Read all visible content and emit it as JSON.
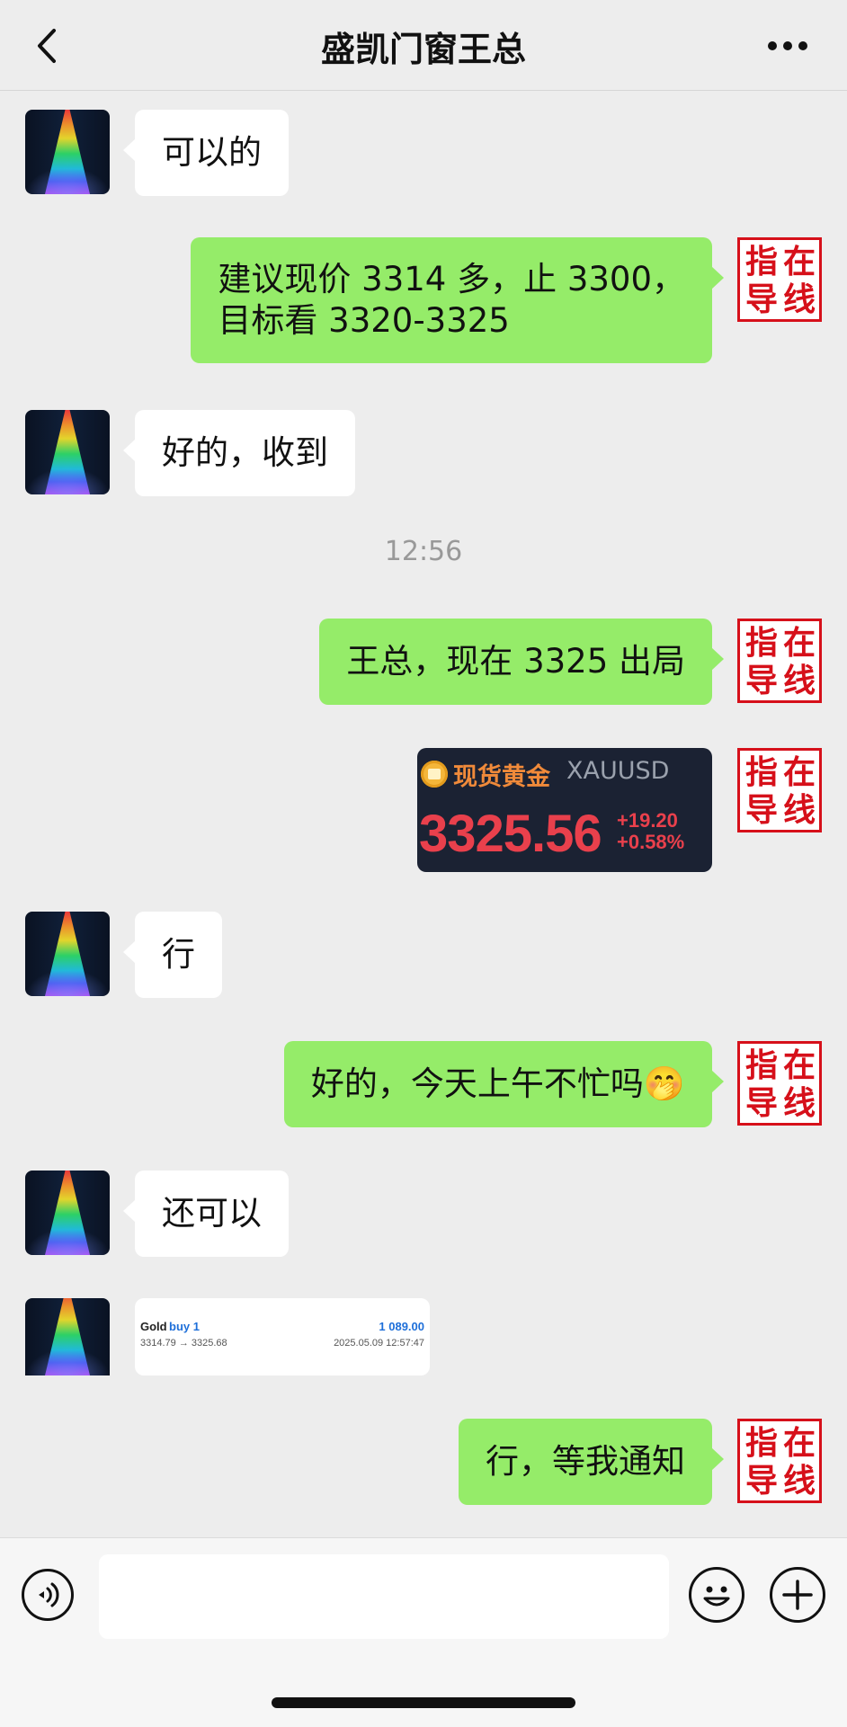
{
  "header": {
    "title": "盛凯门窗王总",
    "back_icon": "chevron-left-icon",
    "more_icon": "more-dots-icon"
  },
  "contact": {
    "avatar": "avatar-tower-lights"
  },
  "me": {
    "avatar_stamp": [
      "指",
      "在",
      "导",
      "线"
    ]
  },
  "messages": [
    {
      "from": "contact",
      "type": "text",
      "text": "可以的"
    },
    {
      "from": "me",
      "type": "text",
      "lines": [
        "建议现价 3314 多，止 3300，",
        "目标看 3320-3325"
      ]
    },
    {
      "from": "contact",
      "type": "text",
      "text": "好的，收到"
    },
    {
      "type": "time",
      "text": "12:56"
    },
    {
      "from": "me",
      "type": "text",
      "text": "王总，现在 3325 出局"
    },
    {
      "from": "me",
      "type": "quote_card",
      "name": "现货黄金",
      "symbol": "XAUUSD",
      "price": "3325.56",
      "change": "+19.20",
      "change_pct": "+0.58%"
    },
    {
      "from": "contact",
      "type": "text",
      "text": "行"
    },
    {
      "from": "me",
      "type": "text",
      "text": "好的，今天上午不忙吗",
      "emoji": "🤭"
    },
    {
      "from": "contact",
      "type": "text",
      "text": "还可以"
    },
    {
      "from": "contact",
      "type": "trade_card",
      "label": "Gold",
      "direction": "buy 1",
      "profit": "1 089.00",
      "prices": "3314.79 → 3325.68",
      "time": "2025.05.09 12:57:47"
    },
    {
      "from": "me",
      "type": "text",
      "text": "行，等我通知"
    }
  ],
  "input_bar": {
    "voice_icon": "voice-icon",
    "emoji_icon": "emoji-icon",
    "plus_icon": "plus-icon",
    "placeholder": ""
  },
  "colors": {
    "outgoing_bubble": "#95ec69",
    "incoming_bubble": "#ffffff",
    "background": "#ededed",
    "stamp_red": "#d6101a"
  }
}
